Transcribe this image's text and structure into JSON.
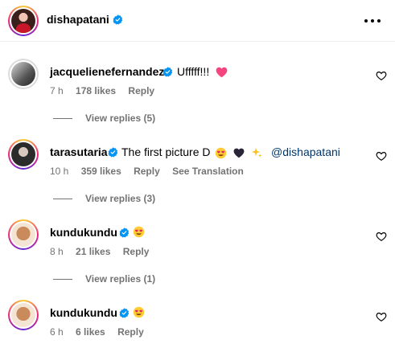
{
  "post_author": {
    "username": "dishapatani",
    "more_icon": "more-horizontal-icon"
  },
  "comments": [
    {
      "username": "jacquelienefernandez",
      "text": "Ufffff!!!",
      "emoji": "pink-heart",
      "time": "7 h",
      "likes": "178 likes",
      "reply": "Reply",
      "view_replies": "View replies (5)"
    },
    {
      "username": "tarasutaria",
      "text": "The first picture D",
      "emoji": "heart-eyes, black-heart, sparkles",
      "mention": "@dishapatani",
      "time": "10 h",
      "likes": "359 likes",
      "reply": "Reply",
      "translation": "See Translation",
      "view_replies": "View replies (3)"
    },
    {
      "username": "kundukundu",
      "emoji": "heart-eyes",
      "time": "8 h",
      "likes": "21 likes",
      "reply": "Reply",
      "view_replies": "View replies (1)"
    },
    {
      "username": "kundukundu",
      "emoji": "heart-eyes",
      "time": "6 h",
      "likes": "6 likes",
      "reply": "Reply"
    }
  ],
  "colors": {
    "verified": "#0095f6",
    "meta": "#737373",
    "mention": "#00376b"
  }
}
